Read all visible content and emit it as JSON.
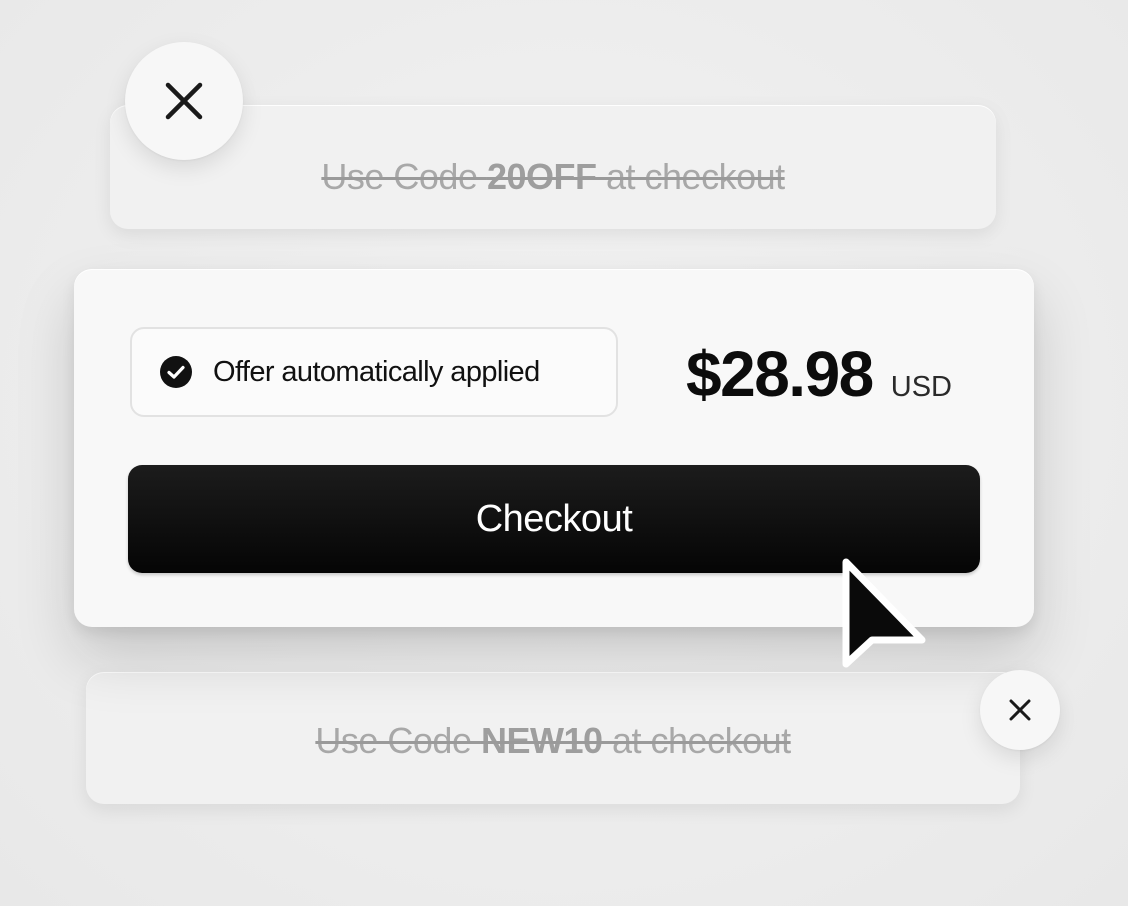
{
  "promos": [
    {
      "prefix": "Use Code ",
      "code": "20OFF",
      "suffix": " at checkout",
      "status": "crossed-out"
    },
    {
      "prefix": "Use Code ",
      "code": "NEW10",
      "suffix": " at checkout",
      "status": "crossed-out"
    }
  ],
  "offer": {
    "label": "Offer automatically applied",
    "icon": "check-circle-icon"
  },
  "price": {
    "amount": "$28.98",
    "currency": "USD"
  },
  "checkout": {
    "label": "Checkout"
  },
  "icons": {
    "dismiss_top": "close-icon",
    "dismiss_bottom": "close-icon",
    "pointer": "mouse-pointer-icon"
  },
  "colors": {
    "background": "#eeeeee",
    "card": "#f8f8f8",
    "button": "#0c0c0c",
    "button_text": "#ffffff",
    "faded_text": "#a8a8a8"
  }
}
